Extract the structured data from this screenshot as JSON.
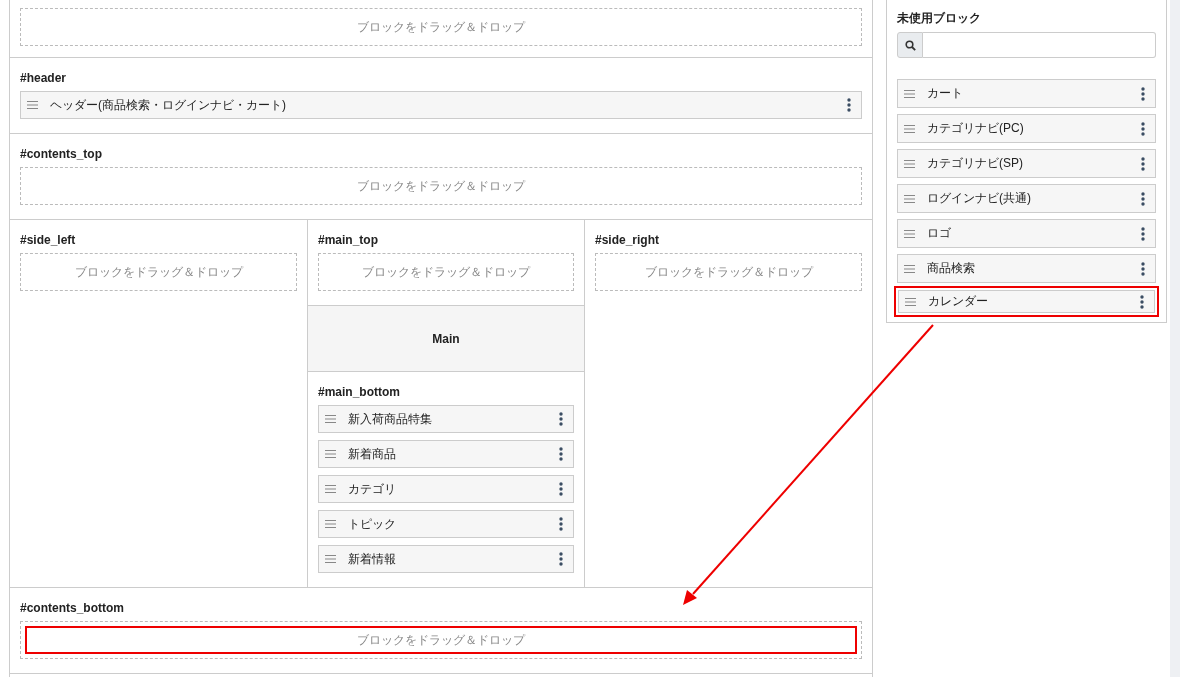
{
  "layout": {
    "sections": [
      {
        "kind": "zone",
        "dropzone": {
          "text": "ブロックをドラッグ＆ドロップ",
          "highlighted": false
        }
      },
      {
        "kind": "zone",
        "label": "#header",
        "blocks": [
          {
            "name": "ヘッダー(商品検索・ログインナビ・カート)",
            "highlighted": false
          }
        ]
      },
      {
        "kind": "zone",
        "label": "#contents_top",
        "dropzone": {
          "text": "ブロックをドラッグ＆ドロップ",
          "highlighted": false
        }
      },
      {
        "kind": "columns",
        "columns": [
          {
            "zones": [
              {
                "kind": "zone",
                "label": "#side_left",
                "dropzone": {
                  "text": "ブロックをドラッグ＆ドロップ",
                  "highlighted": false
                }
              }
            ]
          },
          {
            "zones": [
              {
                "kind": "zone",
                "label": "#main_top",
                "dropzone": {
                  "text": "ブロックをドラッグ＆ドロップ",
                  "highlighted": false
                }
              },
              {
                "kind": "main",
                "text": "Main"
              },
              {
                "kind": "zone",
                "label": "#main_bottom",
                "blocks": [
                  {
                    "name": "新入荷商品特集",
                    "highlighted": false
                  },
                  {
                    "name": "新着商品",
                    "highlighted": false
                  },
                  {
                    "name": "カテゴリ",
                    "highlighted": false
                  },
                  {
                    "name": "トピック",
                    "highlighted": false
                  },
                  {
                    "name": "新着情報",
                    "highlighted": false
                  }
                ]
              }
            ]
          },
          {
            "zones": [
              {
                "kind": "zone",
                "label": "#side_right",
                "dropzone": {
                  "text": "ブロックをドラッグ＆ドロップ",
                  "highlighted": false
                }
              }
            ]
          }
        ]
      },
      {
        "kind": "zone",
        "label": "#contents_bottom",
        "dropzone": {
          "text": "ブロックをドラッグ＆ドロップ",
          "highlighted": true
        }
      },
      {
        "kind": "empty"
      }
    ]
  },
  "unused_panel": {
    "title": "未使用ブロック",
    "blocks": [
      {
        "name": "カート",
        "highlighted": false
      },
      {
        "name": "カテゴリナビ(PC)",
        "highlighted": false
      },
      {
        "name": "カテゴリナビ(SP)",
        "highlighted": false
      },
      {
        "name": "ログインナビ(共通)",
        "highlighted": false
      },
      {
        "name": "ロゴ",
        "highlighted": false
      },
      {
        "name": "商品検索",
        "highlighted": false
      },
      {
        "name": "カレンダー",
        "highlighted": true
      }
    ]
  }
}
